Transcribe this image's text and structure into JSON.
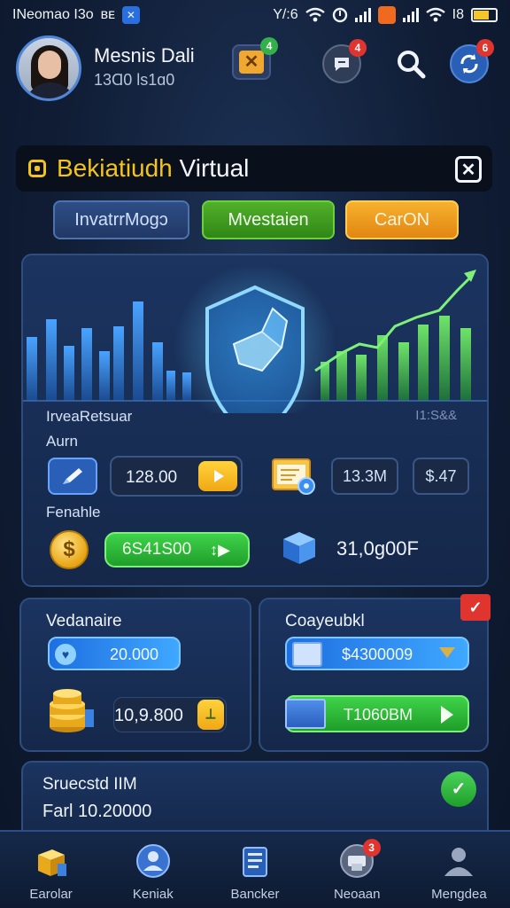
{
  "status_bar": {
    "left_text": "INeomao I3o",
    "left_extra": "ʙᴇ",
    "time": "Y/:6",
    "right_text": "I8"
  },
  "header": {
    "user_name": "Mesnis Dali",
    "user_sub": "13Ɑ0 ls1ɑ0",
    "task_badge": "4",
    "chat_badge": "4",
    "refresh_badge": "6"
  },
  "banner": {
    "title_yellow": "Bekiatiudh",
    "title_white": "Virtual"
  },
  "tabs": [
    {
      "label": "InvatrrMogɔ"
    },
    {
      "label": "Mvestaien"
    },
    {
      "label": "CarON"
    }
  ],
  "main_panel": {
    "chart_label": "IrveaRetsuar",
    "chart_corner": "I1:S&&",
    "aum_label": "Aurn",
    "amount": "128.00",
    "chip_1": "13.3M",
    "chip_2": "$.47",
    "feasible_label": "Fenahle",
    "coin_symbol": "$",
    "green_value": "6S41S00",
    "green_arrow": "↕▶",
    "big_value": "31,0ɡ00F"
  },
  "left_panel": {
    "title": "Vedanaire",
    "blue_value": "20.000",
    "value": "10,9.800",
    "go_label": "⟂"
  },
  "right_panel": {
    "title": "Coayeubkl",
    "check": "✓",
    "blue_value": "$4300009",
    "green_value": "T1060BM"
  },
  "bottom_card": {
    "title": "Sruecstd IIM",
    "subtitle": "Farl 10.20000",
    "check": "✓"
  },
  "nav": [
    {
      "label": "Earolar"
    },
    {
      "label": "Keniak"
    },
    {
      "label": "Bancker"
    },
    {
      "label": "Neoaan",
      "badge": "3"
    },
    {
      "label": "Mengdea"
    }
  ]
}
